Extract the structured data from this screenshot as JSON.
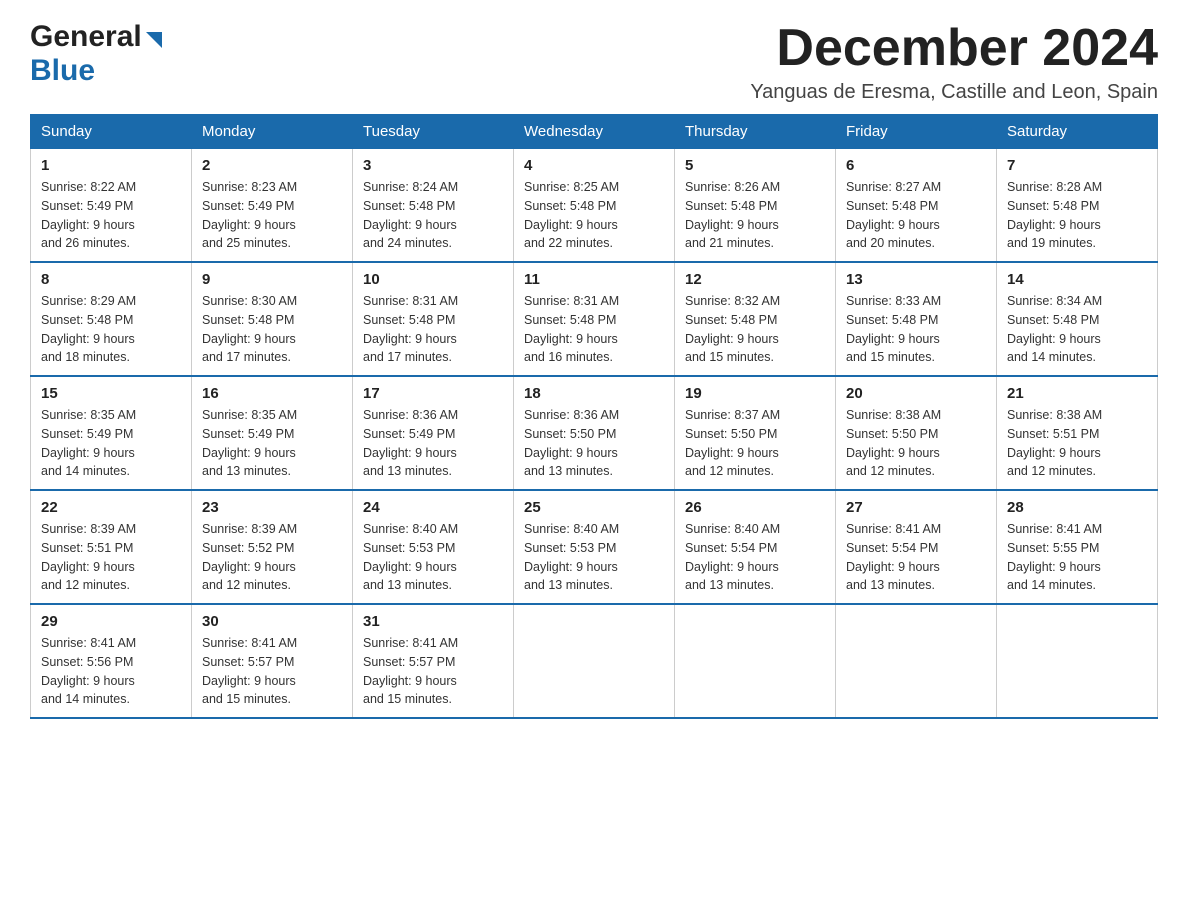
{
  "logo": {
    "general": "General",
    "blue": "Blue",
    "alt": "GeneralBlue logo"
  },
  "title": {
    "month_year": "December 2024",
    "location": "Yanguas de Eresma, Castille and Leon, Spain"
  },
  "days_of_week": [
    "Sunday",
    "Monday",
    "Tuesday",
    "Wednesday",
    "Thursday",
    "Friday",
    "Saturday"
  ],
  "weeks": [
    [
      {
        "day": "1",
        "sunrise": "8:22 AM",
        "sunset": "5:49 PM",
        "daylight": "9 hours and 26 minutes."
      },
      {
        "day": "2",
        "sunrise": "8:23 AM",
        "sunset": "5:49 PM",
        "daylight": "9 hours and 25 minutes."
      },
      {
        "day": "3",
        "sunrise": "8:24 AM",
        "sunset": "5:48 PM",
        "daylight": "9 hours and 24 minutes."
      },
      {
        "day": "4",
        "sunrise": "8:25 AM",
        "sunset": "5:48 PM",
        "daylight": "9 hours and 22 minutes."
      },
      {
        "day": "5",
        "sunrise": "8:26 AM",
        "sunset": "5:48 PM",
        "daylight": "9 hours and 21 minutes."
      },
      {
        "day": "6",
        "sunrise": "8:27 AM",
        "sunset": "5:48 PM",
        "daylight": "9 hours and 20 minutes."
      },
      {
        "day": "7",
        "sunrise": "8:28 AM",
        "sunset": "5:48 PM",
        "daylight": "9 hours and 19 minutes."
      }
    ],
    [
      {
        "day": "8",
        "sunrise": "8:29 AM",
        "sunset": "5:48 PM",
        "daylight": "9 hours and 18 minutes."
      },
      {
        "day": "9",
        "sunrise": "8:30 AM",
        "sunset": "5:48 PM",
        "daylight": "9 hours and 17 minutes."
      },
      {
        "day": "10",
        "sunrise": "8:31 AM",
        "sunset": "5:48 PM",
        "daylight": "9 hours and 17 minutes."
      },
      {
        "day": "11",
        "sunrise": "8:31 AM",
        "sunset": "5:48 PM",
        "daylight": "9 hours and 16 minutes."
      },
      {
        "day": "12",
        "sunrise": "8:32 AM",
        "sunset": "5:48 PM",
        "daylight": "9 hours and 15 minutes."
      },
      {
        "day": "13",
        "sunrise": "8:33 AM",
        "sunset": "5:48 PM",
        "daylight": "9 hours and 15 minutes."
      },
      {
        "day": "14",
        "sunrise": "8:34 AM",
        "sunset": "5:48 PM",
        "daylight": "9 hours and 14 minutes."
      }
    ],
    [
      {
        "day": "15",
        "sunrise": "8:35 AM",
        "sunset": "5:49 PM",
        "daylight": "9 hours and 14 minutes."
      },
      {
        "day": "16",
        "sunrise": "8:35 AM",
        "sunset": "5:49 PM",
        "daylight": "9 hours and 13 minutes."
      },
      {
        "day": "17",
        "sunrise": "8:36 AM",
        "sunset": "5:49 PM",
        "daylight": "9 hours and 13 minutes."
      },
      {
        "day": "18",
        "sunrise": "8:36 AM",
        "sunset": "5:50 PM",
        "daylight": "9 hours and 13 minutes."
      },
      {
        "day": "19",
        "sunrise": "8:37 AM",
        "sunset": "5:50 PM",
        "daylight": "9 hours and 12 minutes."
      },
      {
        "day": "20",
        "sunrise": "8:38 AM",
        "sunset": "5:50 PM",
        "daylight": "9 hours and 12 minutes."
      },
      {
        "day": "21",
        "sunrise": "8:38 AM",
        "sunset": "5:51 PM",
        "daylight": "9 hours and 12 minutes."
      }
    ],
    [
      {
        "day": "22",
        "sunrise": "8:39 AM",
        "sunset": "5:51 PM",
        "daylight": "9 hours and 12 minutes."
      },
      {
        "day": "23",
        "sunrise": "8:39 AM",
        "sunset": "5:52 PM",
        "daylight": "9 hours and 12 minutes."
      },
      {
        "day": "24",
        "sunrise": "8:40 AM",
        "sunset": "5:53 PM",
        "daylight": "9 hours and 13 minutes."
      },
      {
        "day": "25",
        "sunrise": "8:40 AM",
        "sunset": "5:53 PM",
        "daylight": "9 hours and 13 minutes."
      },
      {
        "day": "26",
        "sunrise": "8:40 AM",
        "sunset": "5:54 PM",
        "daylight": "9 hours and 13 minutes."
      },
      {
        "day": "27",
        "sunrise": "8:41 AM",
        "sunset": "5:54 PM",
        "daylight": "9 hours and 13 minutes."
      },
      {
        "day": "28",
        "sunrise": "8:41 AM",
        "sunset": "5:55 PM",
        "daylight": "9 hours and 14 minutes."
      }
    ],
    [
      {
        "day": "29",
        "sunrise": "8:41 AM",
        "sunset": "5:56 PM",
        "daylight": "9 hours and 14 minutes."
      },
      {
        "day": "30",
        "sunrise": "8:41 AM",
        "sunset": "5:57 PM",
        "daylight": "9 hours and 15 minutes."
      },
      {
        "day": "31",
        "sunrise": "8:41 AM",
        "sunset": "5:57 PM",
        "daylight": "9 hours and 15 minutes."
      },
      null,
      null,
      null,
      null
    ]
  ],
  "labels": {
    "sunrise": "Sunrise:",
    "sunset": "Sunset:",
    "daylight": "Daylight:"
  }
}
